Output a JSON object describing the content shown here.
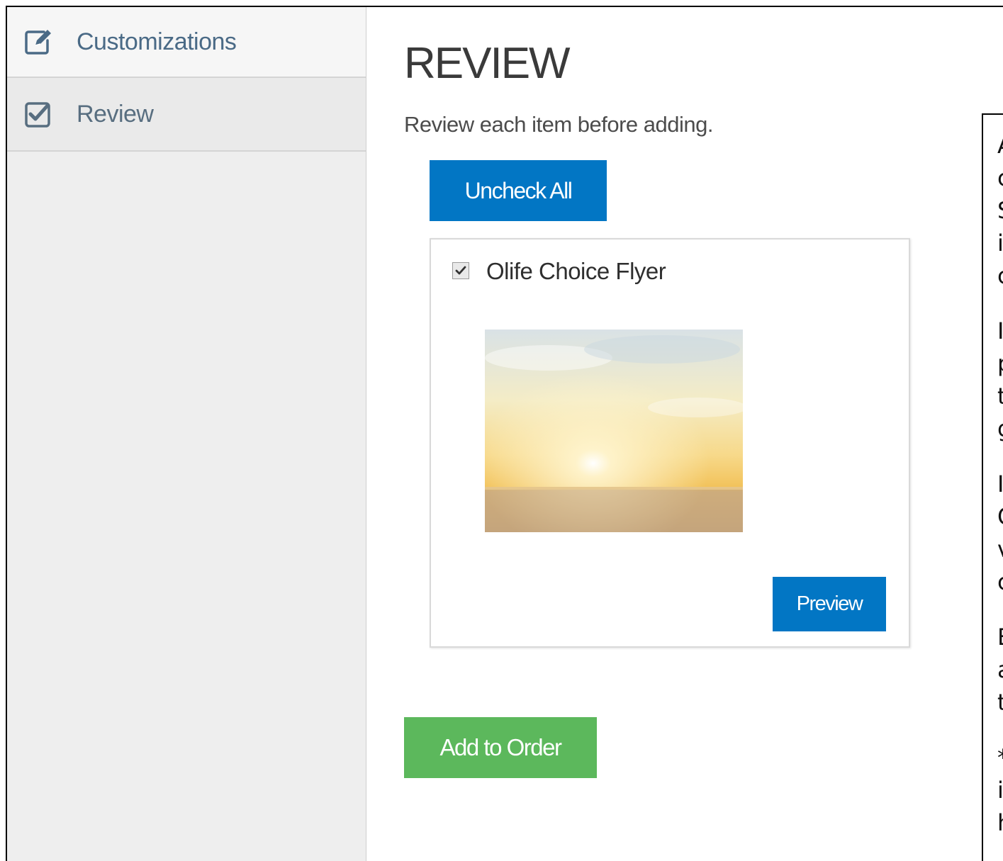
{
  "sidebar": {
    "items": [
      {
        "label": "Customizations",
        "icon": "edit-icon",
        "active": false
      },
      {
        "label": "Review",
        "icon": "checkbox-checked-icon",
        "active": true
      }
    ]
  },
  "main": {
    "title": "REVIEW",
    "subtitle": "Review each item before adding.",
    "uncheck_all_label": "Uncheck All",
    "item": {
      "checked": true,
      "name": "Olife Choice Flyer",
      "preview_label": "Preview"
    },
    "add_to_order_label": "Add to Order"
  },
  "colors": {
    "primary_button": "#0276c4",
    "success_button": "#5cb85c",
    "sidebar_bg": "#eeeeee"
  },
  "annotation": {
    "paragraphs": [
      [
        "A",
        "c",
        "S",
        "i",
        "c"
      ],
      [
        "I",
        "p",
        "t",
        "g"
      ],
      [
        "I",
        "C",
        "v",
        "c"
      ],
      [
        "E",
        "a",
        "t"
      ],
      [
        "*",
        "i",
        "h"
      ]
    ]
  }
}
